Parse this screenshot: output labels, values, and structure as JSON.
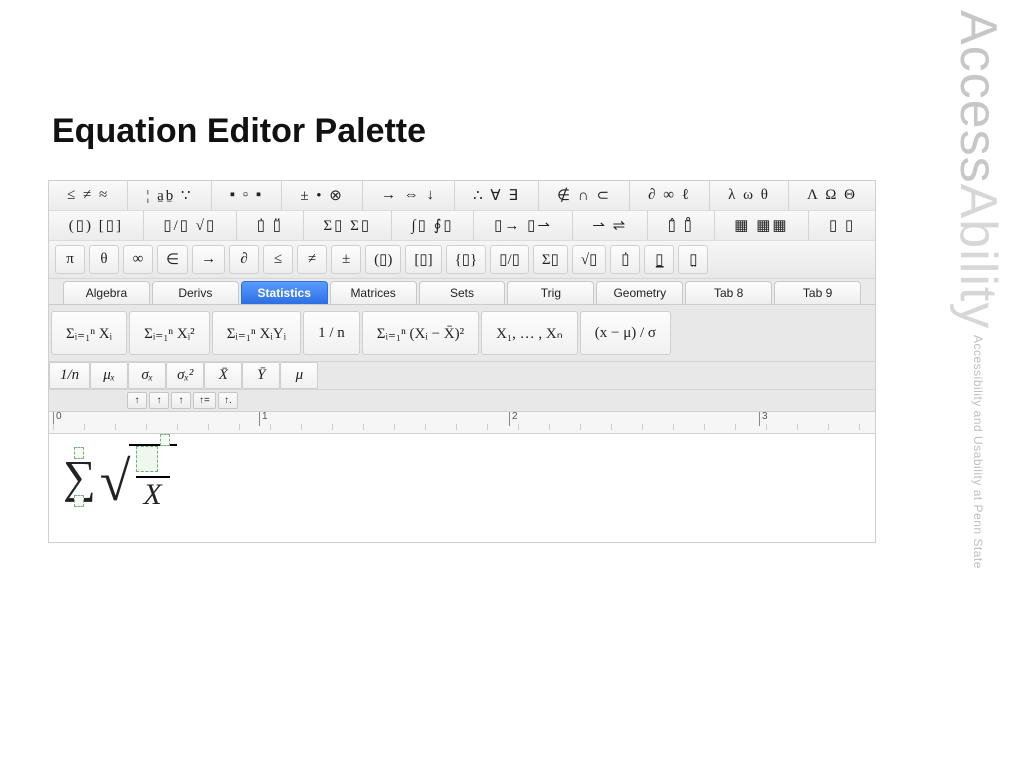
{
  "title": "Equation Editor Palette",
  "brand": {
    "main1": "Access",
    "main2": "Ability",
    "tagline": "Accessibility and Usability at Penn State"
  },
  "toolbar": {
    "row1": [
      "≤ ≠ ≈",
      "¦ a̱ḇ ∵",
      "▪ ▫ ▪",
      "± • ⊗",
      "→ ⇔ ↓",
      "∴ ∀ ∃",
      "∉ ∩ ⊂",
      "∂ ∞ ℓ",
      "λ ω θ",
      "Λ Ω Θ"
    ],
    "row2": [
      "(▯) [▯]",
      "▯/▯  √▯",
      "▯̇  ▯̈",
      "Σ▯ Σ▯",
      "∫▯ ∮▯",
      "▯→ ▯⇀",
      "⇀ ⇌",
      "▯̂  ▯̊",
      "▦ ▦▦",
      "▯  ▯"
    ],
    "row3": [
      "π",
      "θ",
      "∞",
      "∈",
      "→",
      "∂",
      "≤",
      "≠",
      "±",
      "(▯)",
      "[▯]",
      "{▯}",
      "▯/▯",
      "Σ▯",
      "√▯",
      "▯̇",
      "▯̲",
      "▯̤"
    ]
  },
  "tabs": [
    {
      "label": "Algebra",
      "selected": false
    },
    {
      "label": "Derivs",
      "selected": false
    },
    {
      "label": "Statistics",
      "selected": true
    },
    {
      "label": "Matrices",
      "selected": false
    },
    {
      "label": "Sets",
      "selected": false
    },
    {
      "label": "Trig",
      "selected": false
    },
    {
      "label": "Geometry",
      "selected": false
    },
    {
      "label": "Tab 8",
      "selected": false
    },
    {
      "label": "Tab 9",
      "selected": false
    }
  ],
  "formulas": [
    "Σᵢ₌₁ⁿ Xᵢ",
    "Σᵢ₌₁ⁿ Xᵢ²",
    "Σᵢ₌₁ⁿ XᵢYᵢ",
    "1 / n",
    "Σᵢ₌₁ⁿ (Xᵢ − X̄)²",
    "X₁, … , Xₙ",
    "(x − μ) / σ"
  ],
  "vars": [
    "1/n",
    "μₓ",
    "σₓ",
    "σₓ²",
    "X̄",
    "Ȳ",
    "μ"
  ],
  "tiny": [
    "↑",
    "↑",
    "↑",
    "↑=",
    "↑."
  ],
  "ruler": {
    "majors": [
      "0",
      "1",
      "2",
      "3"
    ]
  },
  "canvas_equation": {
    "denominator": "X"
  }
}
